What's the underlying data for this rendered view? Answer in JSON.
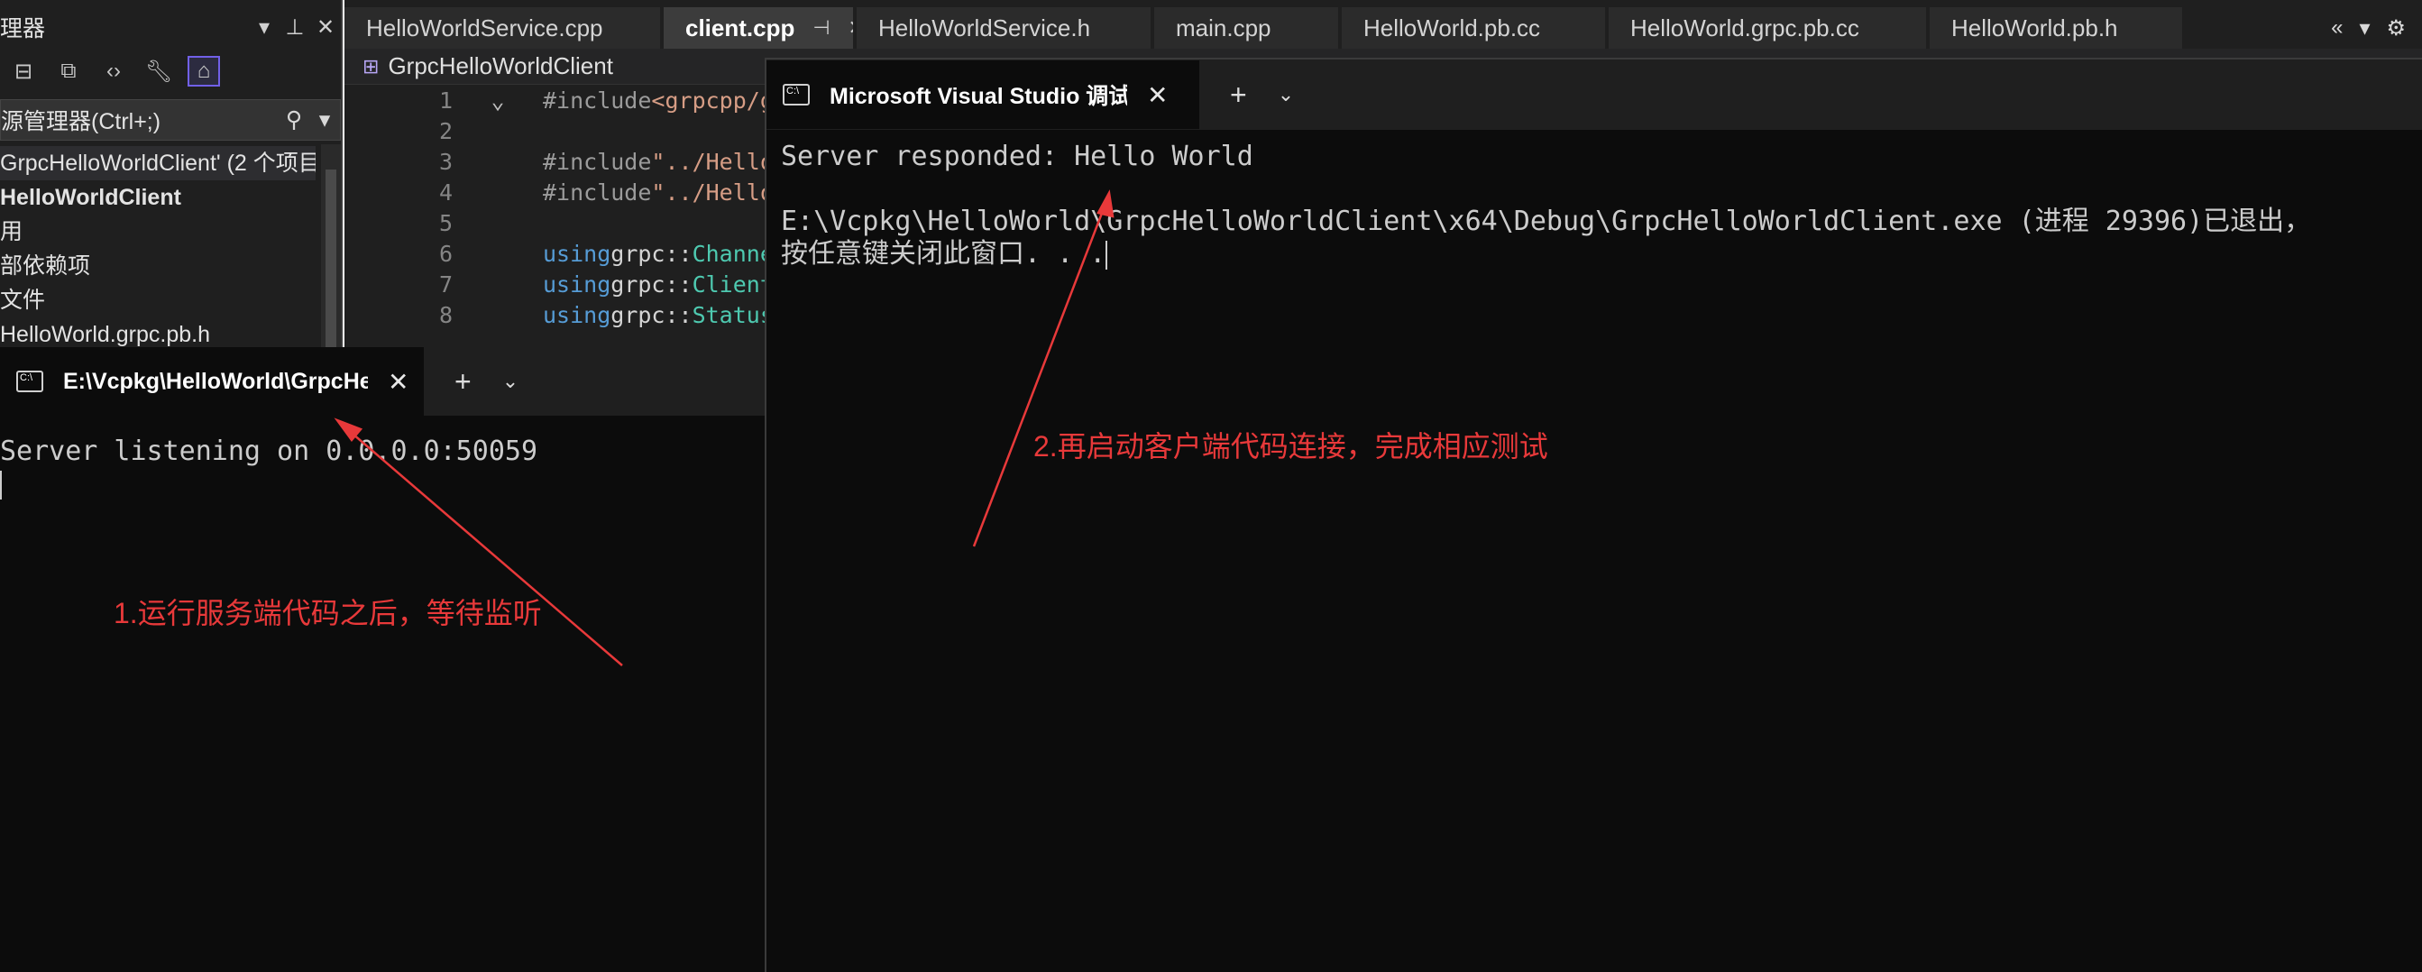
{
  "solution_explorer": {
    "title": "理器",
    "search_placeholder": "源管理器(Ctrl+;)",
    "tree": [
      "GrpcHelloWorldClient' (2 个项目",
      "HelloWorldClient",
      "用",
      "部依赖项",
      "文件",
      "HelloWorld.grpc.pb.h"
    ]
  },
  "editor": {
    "tabs": [
      {
        "label": "HelloWorldService.cpp",
        "active": false
      },
      {
        "label": "client.cpp",
        "active": true
      },
      {
        "label": "HelloWorldService.h",
        "active": false
      },
      {
        "label": "main.cpp",
        "active": false
      },
      {
        "label": "HelloWorld.pb.cc",
        "active": false
      },
      {
        "label": "HelloWorld.grpc.pb.cc",
        "active": false
      },
      {
        "label": "HelloWorld.pb.h",
        "active": false
      }
    ],
    "nav_project": "GrpcHelloWorldClient",
    "line_numbers": [
      "1",
      "2",
      "3",
      "4",
      "5",
      "6",
      "7",
      "8"
    ],
    "code": {
      "l1_pp": "#include ",
      "l1_str": "<grpcpp/g",
      "l3_pp": "#include ",
      "l3_str": "\"../Hello",
      "l4_pp": "#include ",
      "l4_str": "\"../Hello",
      "l6_kw": "using ",
      "l6_tx": "grpc::",
      "l6_ty": "Channe",
      "l7_kw": "using ",
      "l7_tx": "grpc::",
      "l7_ty": "Client",
      "l8_kw": "using ",
      "l8_tx": "grpc::",
      "l8_ty": "Status"
    }
  },
  "server_console": {
    "tab_title": "E:\\Vcpkg\\HelloWorld\\GrpcHel",
    "output_line1": "Server listening on 0.0.0.0:50059"
  },
  "client_console": {
    "tab_title": "Microsoft Visual Studio 调试控",
    "output_line1": "Server responded: Hello World",
    "output_line2": "E:\\Vcpkg\\HelloWorld\\GrpcHelloWorldClient\\x64\\Debug\\GrpcHelloWorldClient.exe (进程 29396)已退出，",
    "output_line3": "按任意键关闭此窗口. . ."
  },
  "annotations": {
    "note1": "1.运行服务端代码之后，等待监听",
    "note2": "2.再启动客户端代码连接，完成相应测试"
  },
  "colors": {
    "annotation": "#e8393a",
    "console_bg": "#0c0c0c",
    "ide_bg": "#1f1f1f"
  }
}
